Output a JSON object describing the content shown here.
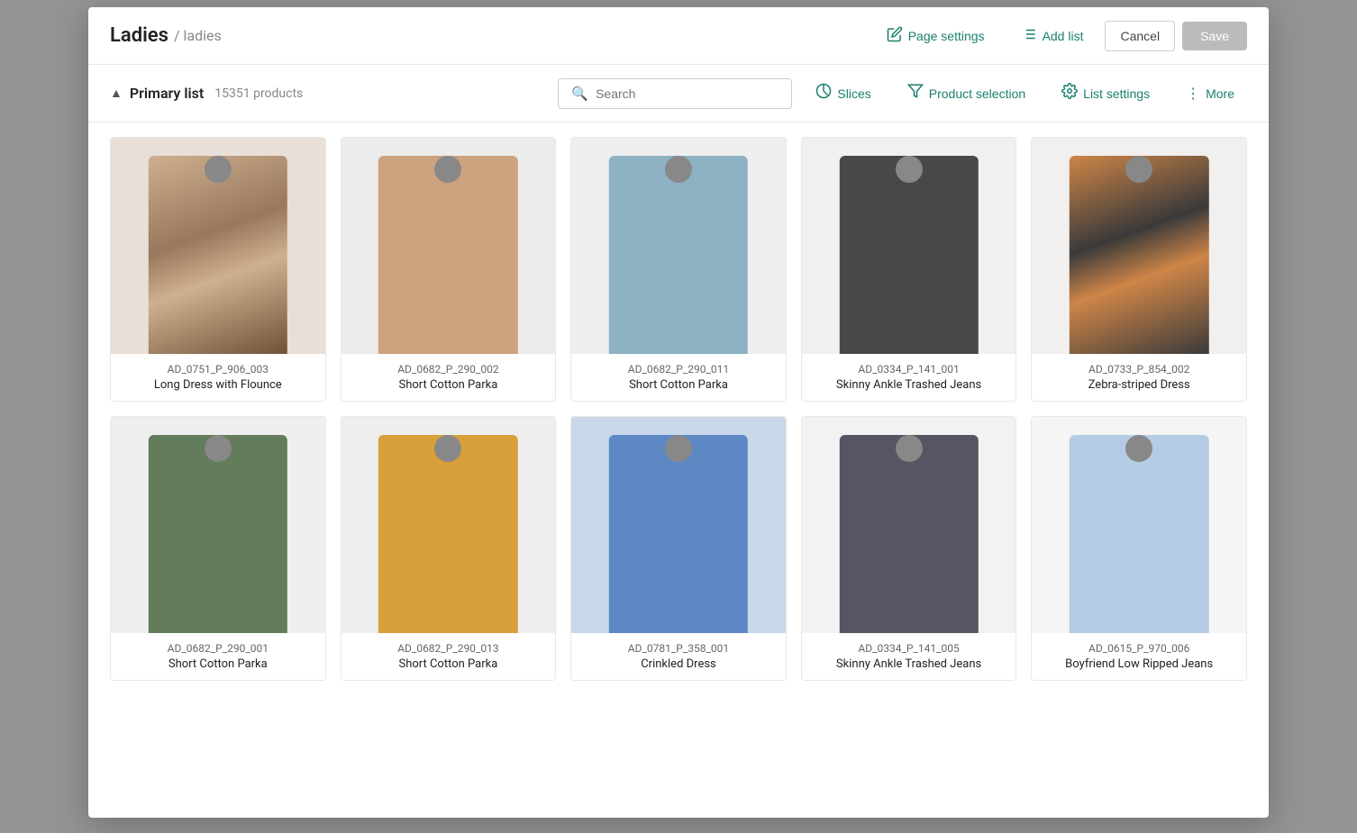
{
  "page": {
    "background_color": "#cccccc"
  },
  "modal": {
    "title": "Ladies",
    "subtitle": "/ ladies",
    "actions": {
      "page_settings_label": "Page settings",
      "add_list_label": "Add list",
      "cancel_label": "Cancel",
      "save_label": "Save"
    }
  },
  "toolbar": {
    "primary_list_label": "Primary list",
    "product_count": "15351 products",
    "search_placeholder": "Search",
    "slices_label": "Slices",
    "product_selection_label": "Product selection",
    "list_settings_label": "List settings",
    "more_label": "More"
  },
  "products": [
    {
      "id": "AD_0751_P_906_003",
      "name": "Long Dress with Flounce",
      "color_class": "figure-zebra",
      "bg": "#e8e0d8"
    },
    {
      "id": "AD_0682_P_290_002",
      "name": "Short Cotton Parka",
      "color_class": "figure-tan",
      "bg": "#ececec"
    },
    {
      "id": "AD_0682_P_290_011",
      "name": "Short Cotton Parka",
      "color_class": "figure-blue-jacket",
      "bg": "#efefef"
    },
    {
      "id": "AD_0334_P_141_001",
      "name": "Skinny Ankle Trashed Jeans",
      "color_class": "figure-black-jeans",
      "bg": "#f0f0f0"
    },
    {
      "id": "AD_0733_P_854_002",
      "name": "Zebra-striped Dress",
      "color_class": "figure-zebra-orange",
      "bg": "#f2f0ee"
    },
    {
      "id": "AD_0682_P_290_001",
      "name": "Short Cotton Parka",
      "color_class": "figure-green-parka",
      "bg": "#efefef"
    },
    {
      "id": "AD_0682_P_290_013",
      "name": "Short Cotton Parka",
      "color_class": "figure-yellow-parka",
      "bg": "#eeeeee"
    },
    {
      "id": "AD_0781_P_358_001",
      "name": "Crinkled Dress",
      "color_class": "figure-floral-blue",
      "bg": "#c8d8e8"
    },
    {
      "id": "AD_0334_P_141_005",
      "name": "Skinny Ankle Trashed Jeans",
      "color_class": "figure-dark-jeans",
      "bg": "#f2f2f2"
    },
    {
      "id": "AD_0615_P_970_006",
      "name": "Boyfriend Low Ripped Jeans",
      "color_class": "figure-light-jeans",
      "bg": "#f5f5f5"
    }
  ]
}
